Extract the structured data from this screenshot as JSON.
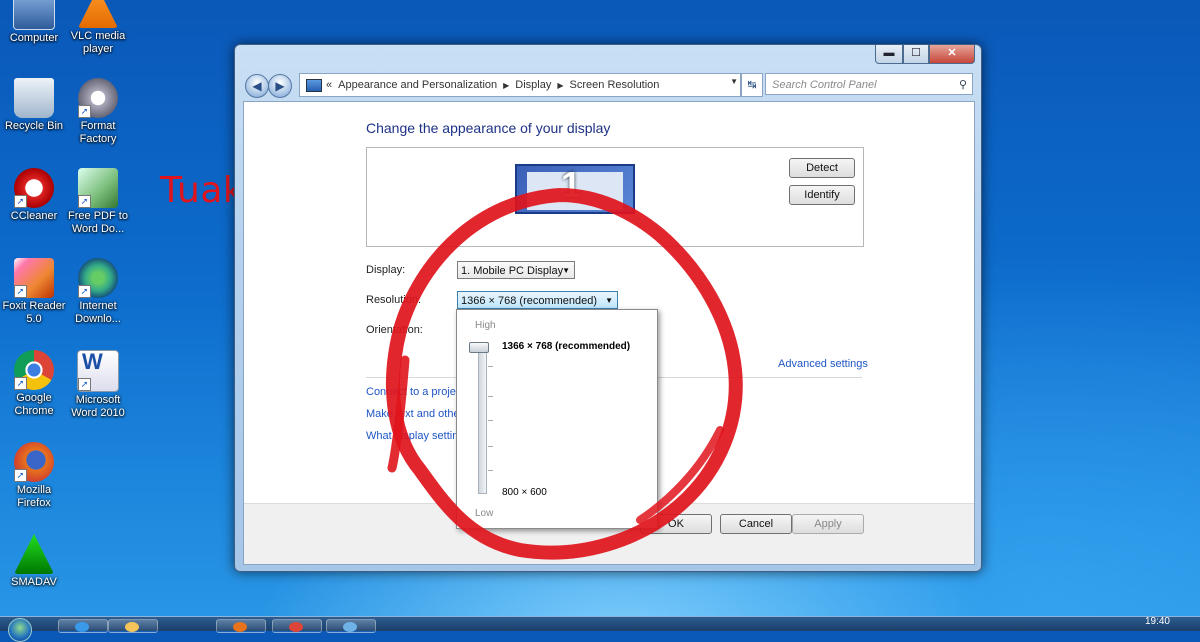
{
  "desktop": {
    "icons": [
      {
        "label": "Computer",
        "icon": "computer-icon"
      },
      {
        "label": "VLC media player",
        "icon": "vlc-icon"
      },
      {
        "label": "Recycle Bin",
        "icon": "recycle-bin-icon"
      },
      {
        "label": "Format Factory",
        "icon": "format-factory-icon"
      },
      {
        "label": "CCleaner",
        "icon": "ccleaner-icon"
      },
      {
        "label": "Free PDF to Word Do...",
        "icon": "pdf-to-word-icon"
      },
      {
        "label": "Foxit Reader 5.0",
        "icon": "foxit-reader-icon"
      },
      {
        "label": "Internet Downlo...",
        "icon": "internet-download-manager-icon"
      },
      {
        "label": "Google Chrome",
        "icon": "chrome-icon"
      },
      {
        "label": "Microsoft Word 2010",
        "icon": "word-icon"
      },
      {
        "label": "Mozilla Firefox",
        "icon": "firefox-icon"
      },
      {
        "label": "SMADAV",
        "icon": "smadav-icon"
      }
    ]
  },
  "watermark": "Tuakang Utak-Atik",
  "window": {
    "caption": {
      "minimize": "▬",
      "maximize": "☐",
      "close": "✕"
    },
    "breadcrumb": {
      "prefix": "«",
      "items": [
        "Appearance and Personalization",
        "Display",
        "Screen Resolution"
      ]
    },
    "search_placeholder": "Search Control Panel",
    "heading": "Change the appearance of your display",
    "monitor_number": "1",
    "detect_label": "Detect",
    "identify_label": "Identify",
    "display_label": "Display:",
    "display_value": "1. Mobile PC Display",
    "resolution_label": "Resolution:",
    "resolution_value": "1366 × 768 (recommended)",
    "orientation_label": "Orientation:",
    "advanced_settings": "Advanced settings",
    "links": [
      "Connect to a projector",
      "Make text and other items larger or smaller",
      "What display settings should I choose?"
    ],
    "ok_label": "OK",
    "cancel_label": "Cancel",
    "apply_label": "Apply"
  },
  "resolution_dropdown": {
    "high_label": "High",
    "low_label": "Low",
    "top_option": "1366 × 768 (recommended)",
    "bottom_option": "800 × 600",
    "slider_level": 1.0
  },
  "taskbar": {
    "clock": "19:40"
  },
  "colors": {
    "annotation": "#e0141c",
    "link": "#1f55c4",
    "heading": "#1e3287"
  }
}
